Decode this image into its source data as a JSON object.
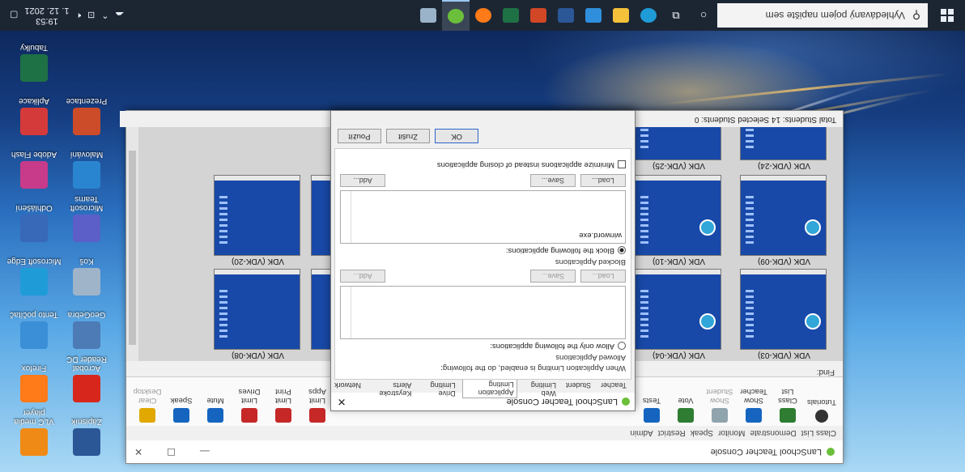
{
  "taskbar": {
    "search_placeholder": "Vyhledávaný pojem napište sem",
    "time": "19:53",
    "date": "1. 12. 2021"
  },
  "desktop_icons": [
    {
      "label": "VLC media player",
      "icon": "vlc-icon",
      "color": "#f08a16"
    },
    {
      "label": "Zápisník",
      "icon": "word-icon",
      "color": "#2b5797"
    },
    {
      "label": "Firefox",
      "icon": "firefox-icon",
      "color": "#ff7a18"
    },
    {
      "label": "Acrobat Reader DC",
      "icon": "acrobat-icon",
      "color": "#d7271d"
    },
    {
      "label": "Tento počítač",
      "icon": "folder-icon",
      "color": "#3a8fd6"
    },
    {
      "label": "GeoGebra",
      "icon": "geogebra-icon",
      "color": "#4d7bb5"
    },
    {
      "label": "Microsoft Edge",
      "icon": "edge-icon",
      "color": "#1f9cd8"
    },
    {
      "label": "Koš",
      "icon": "recycle-bin-icon",
      "color": "#9fb4c9"
    },
    {
      "label": "Odhlášení",
      "icon": "logout-icon",
      "color": "#3868b8"
    },
    {
      "label": "Microsoft Teams",
      "icon": "teams-icon",
      "color": "#5b5fc7"
    },
    {
      "label": "Adobe Flash",
      "icon": "flash-icon",
      "color": "#c73b8a"
    },
    {
      "label": "Malování",
      "icon": "paint-icon",
      "color": "#2a85d0"
    },
    {
      "label": "Aplikace",
      "icon": "app-icon",
      "color": "#d43a3a"
    },
    {
      "label": "Prezentace",
      "icon": "presentation-icon",
      "color": "#cc4c2a"
    },
    {
      "label": "Tabulky",
      "icon": "table-icon",
      "color": "#1e7145"
    }
  ],
  "console": {
    "title": "LanSchool Teacher Console",
    "tabs": [
      "Class List",
      "Demonstrate",
      "Monitor",
      "Speak",
      "Restrict",
      "Admin"
    ],
    "ribbon": [
      {
        "label": "Tutorials",
        "icon": "help-icon",
        "color": "#333333"
      },
      {
        "label": "Class List",
        "icon": "class-list-icon",
        "color": "#2e7d32"
      },
      {
        "label": "Show Teacher",
        "icon": "show-teacher-icon",
        "color": "#1565c0"
      },
      {
        "label": "Show Student",
        "icon": "show-student-icon",
        "color": "#90a4ae"
      },
      {
        "label": "Vote",
        "icon": "vote-icon",
        "color": "#2e7d32"
      },
      {
        "label": "Tests",
        "icon": "tests-icon",
        "color": "#1565c0"
      }
    ],
    "ribbon_right": [
      {
        "label": "Limit Apps",
        "icon": "limit-apps-icon",
        "color": "#c62828"
      },
      {
        "label": "Limit Print",
        "icon": "limit-print-icon",
        "color": "#c62828"
      },
      {
        "label": "Limit Drives",
        "icon": "limit-drives-icon",
        "color": "#c62828"
      },
      {
        "label": "Mute",
        "icon": "mute-icon",
        "color": "#1565c0"
      },
      {
        "label": "Speak",
        "icon": "speak-icon",
        "color": "#1565c0"
      },
      {
        "label": "Clear Desktop",
        "icon": "clear-desktop-icon",
        "color": "#e0a800"
      }
    ],
    "find_label": "Find:",
    "status": "Total Students: 14  Selected Students: 0",
    "thumbnails": [
      {
        "label": "VDK (VDK-03)"
      },
      {
        "label": "VDK (VDK-04)"
      },
      {
        "label": "VDK (VDK-08)"
      },
      {
        "label": "VDK (VDK-09)"
      },
      {
        "label": "VDK (VDK-10)"
      },
      {
        "label": "VDK (VDK-20)"
      },
      {
        "label": "VDK (VDK-24)"
      },
      {
        "label": "VDK (VDK-25)"
      }
    ]
  },
  "dialog": {
    "title": "LanSchool Teacher Console",
    "close": "✕",
    "tabs": [
      "Teacher",
      "Student",
      "Web Limiting",
      "Application Limiting",
      "Drive Limiting",
      "Keystroke Alerts",
      "Network"
    ],
    "selected_tab": 3,
    "intro": "When Application Limiting is enabled, do the following:",
    "allowed_group": "Allowed Applications",
    "allowed_radio": "Allow only the following applications:",
    "allowed_buttons": {
      "load": "Load...",
      "save": "Save...",
      "add": "Add..."
    },
    "blocked_group": "Blocked Applications",
    "blocked_radio": "Block the following applications:",
    "blocked_items": [
      "winword.exe"
    ],
    "blocked_buttons": {
      "load": "Load...",
      "save": "Save...",
      "add": "Add..."
    },
    "minimize_check": "Minimize applications instead of closing applications",
    "footer": {
      "ok": "OK",
      "cancel": "Zrušit",
      "apply": "Použít"
    }
  }
}
